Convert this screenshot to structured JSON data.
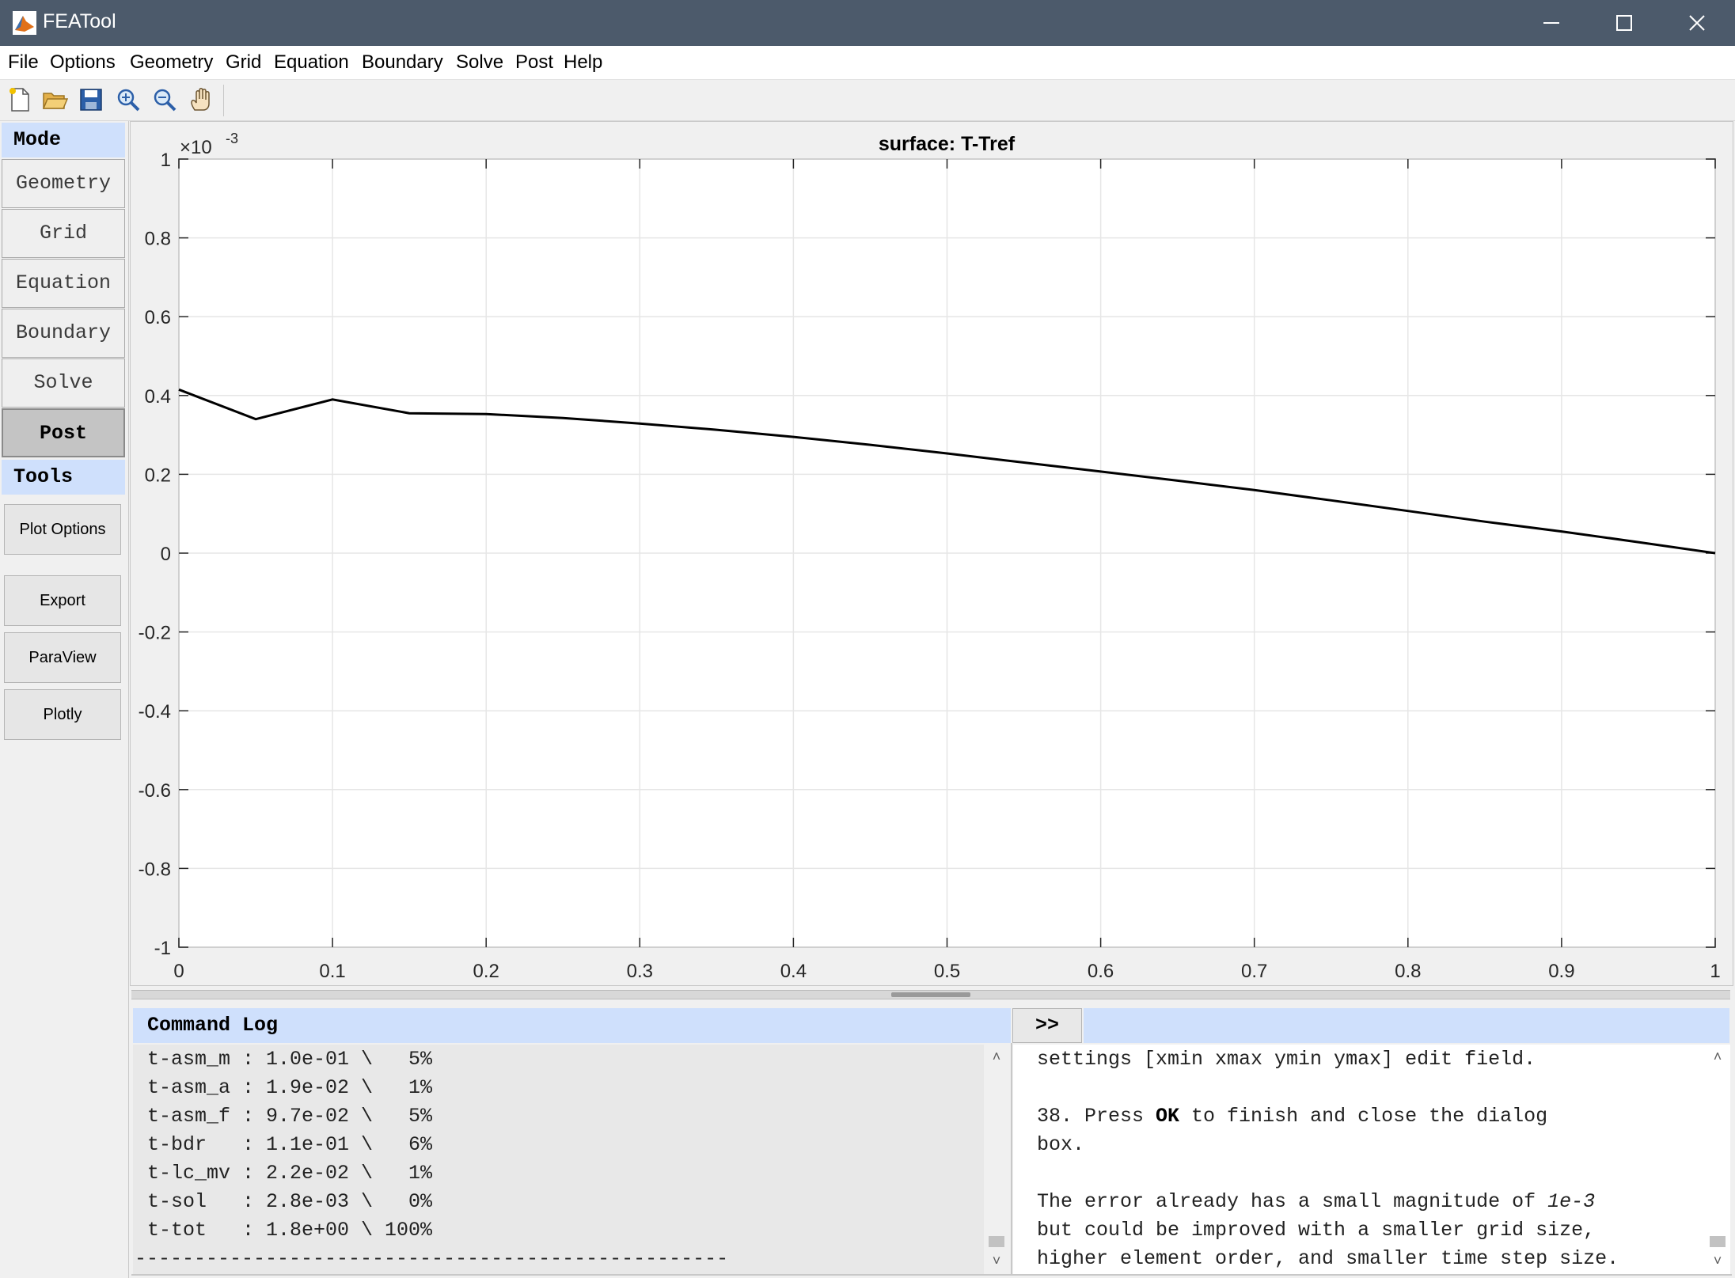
{
  "window": {
    "title": "FEATool"
  },
  "menu": [
    "File",
    "Options",
    "Geometry",
    "Grid",
    "Equation",
    "Boundary",
    "Solve",
    "Post",
    "Help"
  ],
  "toolbar": [
    "new-file-icon",
    "open-folder-icon",
    "save-icon",
    "zoom-in-icon",
    "zoom-out-icon",
    "pan-hand-icon"
  ],
  "sidebar": {
    "mode_header": "Mode",
    "modes": [
      "Geometry",
      "Grid",
      "Equation",
      "Boundary",
      "Solve",
      "Post"
    ],
    "active_mode": "Post",
    "tools_header": "Tools",
    "tools": [
      "Plot Options",
      "Export",
      "ParaView",
      "Plotly"
    ]
  },
  "chart_data": {
    "type": "line",
    "title": "surface: T-Tref",
    "y_exponent_base": "×10",
    "y_exponent_power": "-3",
    "xlim": [
      0,
      1
    ],
    "ylim": [
      -1,
      1
    ],
    "xticks": [
      "0",
      "0.1",
      "0.2",
      "0.3",
      "0.4",
      "0.5",
      "0.6",
      "0.7",
      "0.8",
      "0.9",
      "1"
    ],
    "yticks": [
      "1",
      "0.8",
      "0.6",
      "0.4",
      "0.2",
      "0",
      "-0.2",
      "-0.4",
      "-0.6",
      "-0.8",
      "-1"
    ],
    "grid": true,
    "series": [
      {
        "color": "#000000",
        "x": [
          0,
          0.05,
          0.1,
          0.15,
          0.2,
          0.25,
          0.3,
          0.35,
          0.4,
          0.45,
          0.5,
          0.55,
          0.6,
          0.65,
          0.7,
          0.75,
          0.8,
          0.85,
          0.9,
          0.95,
          1.0
        ],
        "y": [
          0.415,
          0.34,
          0.39,
          0.355,
          0.353,
          0.343,
          0.329,
          0.313,
          0.295,
          0.275,
          0.253,
          0.23,
          0.207,
          0.184,
          0.16,
          0.134,
          0.107,
          0.08,
          0.055,
          0.028,
          0.0
        ]
      }
    ]
  },
  "command_log": {
    "header": "Command Log",
    "expand_label": ">>",
    "lines": [
      "t-asm_m : 1.0e-01 \\   5%",
      "t-asm_a : 1.9e-02 \\   1%",
      "t-asm_f : 9.7e-02 \\   5%",
      "t-bdr   : 1.1e-01 \\   6%",
      "t-lc_mv : 2.2e-02 \\   1%",
      "t-sol   : 2.8e-03 \\   0%",
      "t-tot   : 1.8e+00 \\ 100%"
    ],
    "rule": "--------------------------------------------------"
  },
  "help_text": {
    "line1": "settings [xmin xmax ymin ymax] edit field.",
    "line2_pre": "38. Press ",
    "line2_bold": "OK",
    "line2_post": " to finish and close the dialog",
    "line3": "box.",
    "line4_pre": "The error already has a small magnitude of ",
    "line4_italic": "1e-3",
    "line5": "but could be improved with a smaller grid size,",
    "line6": "higher element order, and smaller time step size."
  },
  "colors": {
    "titlebar": "#4c5a6b",
    "header_blue": "#cfe0fc",
    "active_mode": "#c4c4c4"
  }
}
